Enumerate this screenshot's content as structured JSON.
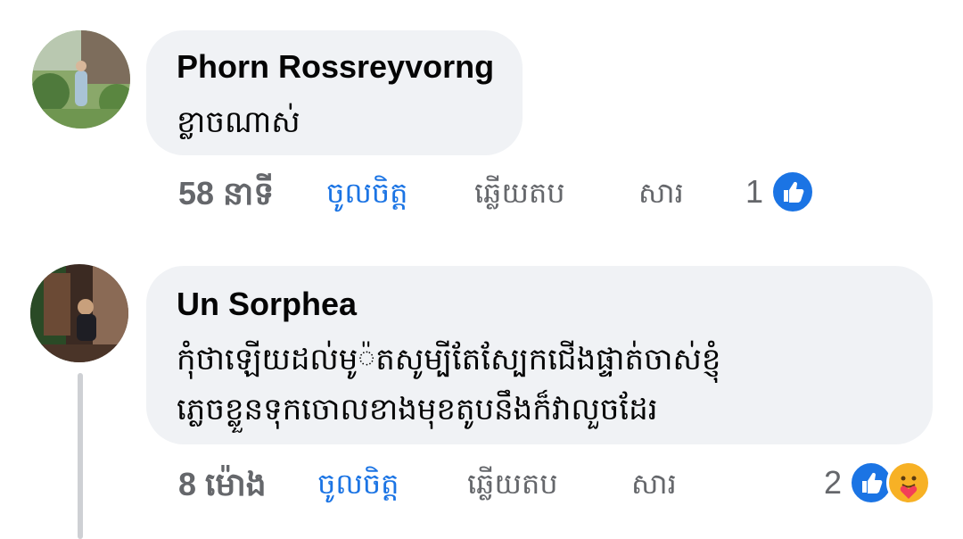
{
  "comments": [
    {
      "author": "Phorn Rossreyvorng",
      "text_lines": [
        "ខ្លាចណាស់"
      ],
      "time": "58 នាទី",
      "like_label": "ចូលចិត្ត",
      "reply_label": "ឆ្លើយតប",
      "message_label": "សារ",
      "reaction_count": "1",
      "reactions": [
        "like-icon"
      ]
    },
    {
      "author": "Un Sorphea",
      "text_lines": [
        "កុំថាឡើយដល់មូ៉តសូម្បីតែស្បែកជើងផ្ទាត់ចាស់ខ្ញុំ",
        "ភ្លេចខ្លួនទុកចោលខាងមុខតូបនឹងក៏វាលួចដែរ"
      ],
      "time": "8 ម៉ោង",
      "like_label": "ចូលចិត្ត",
      "reply_label": "ឆ្លើយតប",
      "message_label": "សារ",
      "reaction_count": "2",
      "reactions": [
        "like-icon",
        "care-icon"
      ]
    }
  ],
  "colors": {
    "bubble": "#f0f2f5",
    "meta_text": "#65676b",
    "like_blue": "#1b74e4",
    "care_yellow": "#f7b125",
    "heart_red": "#f33e58"
  }
}
